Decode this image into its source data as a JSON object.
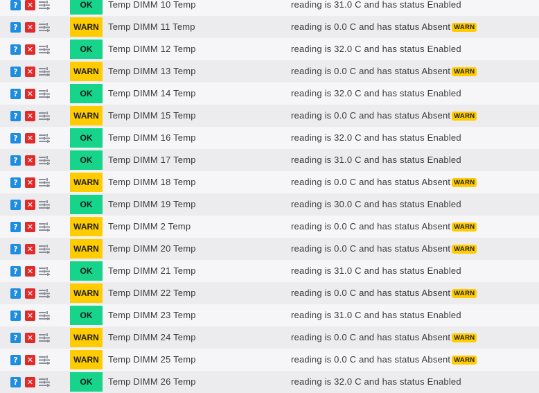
{
  "icons": {
    "help_glyph": "?",
    "delete_glyph": "✕",
    "menu": "menu-lines-icon"
  },
  "colors": {
    "ok": "#16d48a",
    "warn": "#ffcc00",
    "help": "#1e8de0",
    "delete": "#e12b2b"
  },
  "rows": [
    {
      "state": "OK",
      "service": "Temp DIMM 10 Temp",
      "output": "reading is 31.0 C and has status Enabled",
      "tag": ""
    },
    {
      "state": "WARN",
      "service": "Temp DIMM 11 Temp",
      "output": "reading is 0.0 C and has status Absent",
      "tag": "WARN"
    },
    {
      "state": "OK",
      "service": "Temp DIMM 12 Temp",
      "output": "reading is 32.0 C and has status Enabled",
      "tag": ""
    },
    {
      "state": "WARN",
      "service": "Temp DIMM 13 Temp",
      "output": "reading is 0.0 C and has status Absent",
      "tag": "WARN"
    },
    {
      "state": "OK",
      "service": "Temp DIMM 14 Temp",
      "output": "reading is 32.0 C and has status Enabled",
      "tag": ""
    },
    {
      "state": "WARN",
      "service": "Temp DIMM 15 Temp",
      "output": "reading is 0.0 C and has status Absent",
      "tag": "WARN"
    },
    {
      "state": "OK",
      "service": "Temp DIMM 16 Temp",
      "output": "reading is 32.0 C and has status Enabled",
      "tag": ""
    },
    {
      "state": "OK",
      "service": "Temp DIMM 17 Temp",
      "output": "reading is 31.0 C and has status Enabled",
      "tag": ""
    },
    {
      "state": "WARN",
      "service": "Temp DIMM 18 Temp",
      "output": "reading is 0.0 C and has status Absent",
      "tag": "WARN"
    },
    {
      "state": "OK",
      "service": "Temp DIMM 19 Temp",
      "output": "reading is 30.0 C and has status Enabled",
      "tag": ""
    },
    {
      "state": "WARN",
      "service": "Temp DIMM 2 Temp",
      "output": "reading is 0.0 C and has status Absent",
      "tag": "WARN"
    },
    {
      "state": "WARN",
      "service": "Temp DIMM 20 Temp",
      "output": "reading is 0.0 C and has status Absent",
      "tag": "WARN"
    },
    {
      "state": "OK",
      "service": "Temp DIMM 21 Temp",
      "output": "reading is 31.0 C and has status Enabled",
      "tag": ""
    },
    {
      "state": "WARN",
      "service": "Temp DIMM 22 Temp",
      "output": "reading is 0.0 C and has status Absent",
      "tag": "WARN"
    },
    {
      "state": "OK",
      "service": "Temp DIMM 23 Temp",
      "output": "reading is 31.0 C and has status Enabled",
      "tag": ""
    },
    {
      "state": "WARN",
      "service": "Temp DIMM 24 Temp",
      "output": "reading is 0.0 C and has status Absent",
      "tag": "WARN"
    },
    {
      "state": "WARN",
      "service": "Temp DIMM 25 Temp",
      "output": "reading is 0.0 C and has status Absent",
      "tag": "WARN"
    },
    {
      "state": "OK",
      "service": "Temp DIMM 26 Temp",
      "output": "reading is 32.0 C and has status Enabled",
      "tag": ""
    }
  ]
}
